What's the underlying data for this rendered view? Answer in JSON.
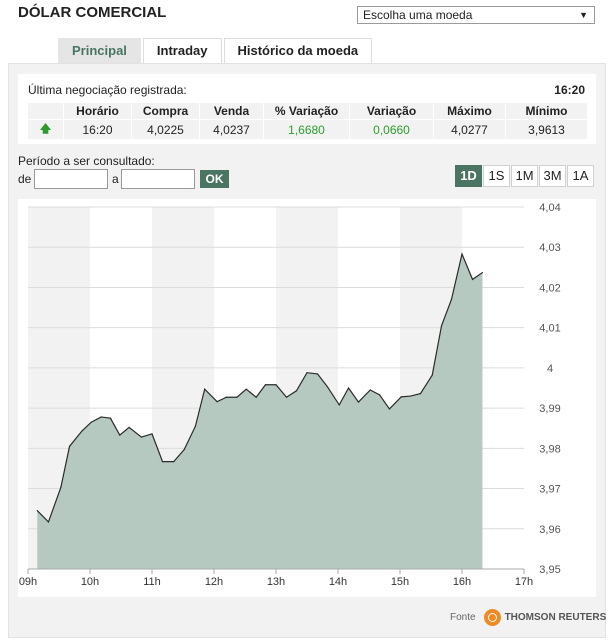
{
  "header": {
    "title": "DÓLAR COMERCIAL",
    "currency_select": {
      "selected": "Escolha uma moeda",
      "arrow_icon": "triangle-down-icon"
    }
  },
  "tabs": [
    {
      "label": "Principal",
      "active": true
    },
    {
      "label": "Intraday",
      "active": false
    },
    {
      "label": "Histórico da moeda",
      "active": false
    }
  ],
  "quote": {
    "caption": "Última negociação registrada:",
    "time": "16:20",
    "headers": [
      "",
      "Horário",
      "Compra",
      "Venda",
      "% Variação",
      "Variação",
      "Máximo",
      "Mínimo"
    ],
    "row": {
      "trend_icon": "arrow-up-icon",
      "horario": "16:20",
      "compra": "4,0225",
      "venda": "4,0237",
      "pct_variacao": "1,6680",
      "variacao": "0,0660",
      "maximo": "4,0277",
      "minimo": "3,9613"
    },
    "positive_color": "#2ea02e"
  },
  "period": {
    "label": "Período a ser consultado:",
    "de_label": "de",
    "a_label": "a",
    "from_value": "",
    "to_value": "",
    "ok_label": "OK"
  },
  "range_buttons": [
    {
      "label": "1D",
      "active": true
    },
    {
      "label": "1S",
      "active": false
    },
    {
      "label": "1M",
      "active": false
    },
    {
      "label": "3M",
      "active": false
    },
    {
      "label": "1A",
      "active": false
    }
  ],
  "source": {
    "label": "Fonte",
    "brand": "THOMSON REUTERS",
    "logo_icon": "thomson-reuters-logo"
  },
  "colors": {
    "accent": "#4a7563",
    "area_fill": "#b5c9c0",
    "line": "#2b2b2b"
  },
  "chart_data": {
    "type": "area",
    "title": "",
    "xlabel": "",
    "ylabel": "",
    "x_ticks": [
      "09h",
      "10h",
      "11h",
      "12h",
      "13h",
      "14h",
      "15h",
      "16h",
      "17h"
    ],
    "y_ticks": [
      "3,95",
      "3,96",
      "3,97",
      "3,98",
      "3,99",
      "4",
      "4,01",
      "4,02",
      "4,03",
      "4,04"
    ],
    "ylim": [
      3.95,
      4.04
    ],
    "xlim": [
      9,
      17
    ],
    "grid": true,
    "series": [
      {
        "points": [
          [
            9.15,
            3.9645
          ],
          [
            9.33,
            3.9617
          ],
          [
            9.53,
            3.9703
          ],
          [
            9.67,
            3.9805
          ],
          [
            9.87,
            3.9843
          ],
          [
            10.02,
            3.9865
          ],
          [
            10.18,
            3.9878
          ],
          [
            10.33,
            3.9875
          ],
          [
            10.48,
            3.9833
          ],
          [
            10.63,
            3.9852
          ],
          [
            10.83,
            3.9828
          ],
          [
            11.0,
            3.9836
          ],
          [
            11.17,
            3.9767
          ],
          [
            11.35,
            3.9767
          ],
          [
            11.52,
            3.9797
          ],
          [
            11.7,
            3.9855
          ],
          [
            11.85,
            3.9947
          ],
          [
            12.05,
            3.9916
          ],
          [
            12.2,
            3.9927
          ],
          [
            12.37,
            3.9927
          ],
          [
            12.52,
            3.9947
          ],
          [
            12.68,
            3.9927
          ],
          [
            12.83,
            3.9958
          ],
          [
            13.0,
            3.9958
          ],
          [
            13.17,
            3.9927
          ],
          [
            13.33,
            3.9943
          ],
          [
            13.5,
            3.9988
          ],
          [
            13.67,
            3.9985
          ],
          [
            13.83,
            3.9953
          ],
          [
            14.02,
            3.9908
          ],
          [
            14.17,
            3.995
          ],
          [
            14.33,
            3.9915
          ],
          [
            14.52,
            3.9945
          ],
          [
            14.67,
            3.9933
          ],
          [
            14.83,
            3.9898
          ],
          [
            15.02,
            3.9928
          ],
          [
            15.17,
            3.993
          ],
          [
            15.33,
            3.9936
          ],
          [
            15.52,
            3.9982
          ],
          [
            15.67,
            4.0105
          ],
          [
            15.83,
            4.017
          ],
          [
            16.0,
            4.0283
          ],
          [
            16.17,
            4.022
          ],
          [
            16.33,
            4.0237
          ]
        ]
      }
    ]
  }
}
